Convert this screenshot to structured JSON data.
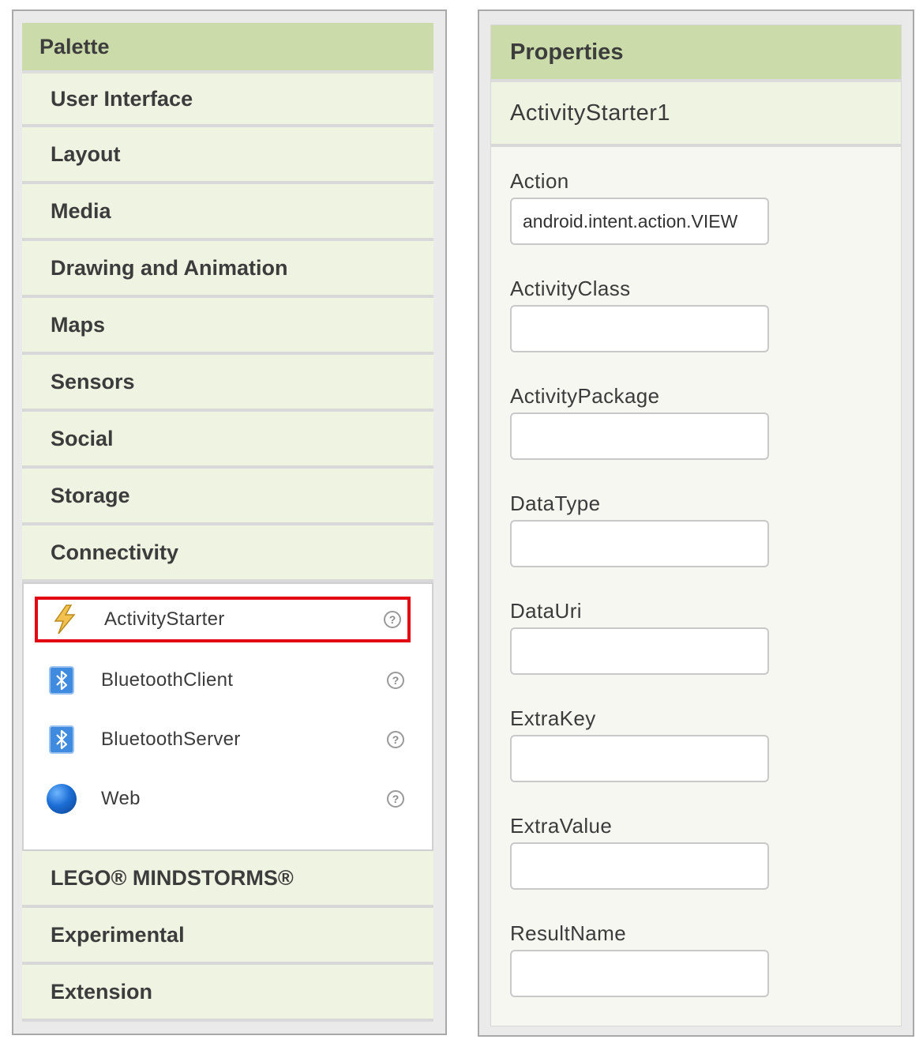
{
  "palette": {
    "title": "Palette",
    "categories_before": [
      "User Interface",
      "Layout",
      "Media",
      "Drawing and Animation",
      "Maps",
      "Sensors",
      "Social",
      "Storage",
      "Connectivity"
    ],
    "connectivity_items": [
      {
        "label": "ActivityStarter",
        "icon": "lightning-icon",
        "selected": true
      },
      {
        "label": "BluetoothClient",
        "icon": "bluetooth-icon",
        "selected": false
      },
      {
        "label": "BluetoothServer",
        "icon": "bluetooth-icon",
        "selected": false
      },
      {
        "label": "Web",
        "icon": "globe-icon",
        "selected": false
      }
    ],
    "help_glyph": "?",
    "categories_after": [
      "LEGO® MINDSTORMS®",
      "Experimental",
      "Extension"
    ]
  },
  "properties": {
    "title": "Properties",
    "component": "ActivityStarter1",
    "fields": [
      {
        "label": "Action",
        "value": "android.intent.action.VIEW"
      },
      {
        "label": "ActivityClass",
        "value": ""
      },
      {
        "label": "ActivityPackage",
        "value": ""
      },
      {
        "label": "DataType",
        "value": ""
      },
      {
        "label": "DataUri",
        "value": ""
      },
      {
        "label": "ExtraKey",
        "value": ""
      },
      {
        "label": "ExtraValue",
        "value": ""
      },
      {
        "label": "ResultName",
        "value": ""
      }
    ]
  },
  "colors": {
    "header_bg": "#cbdcaa",
    "category_bg": "#eef3e2",
    "selection_border": "#e30613",
    "bluetooth_blue": "#3f8be0"
  }
}
